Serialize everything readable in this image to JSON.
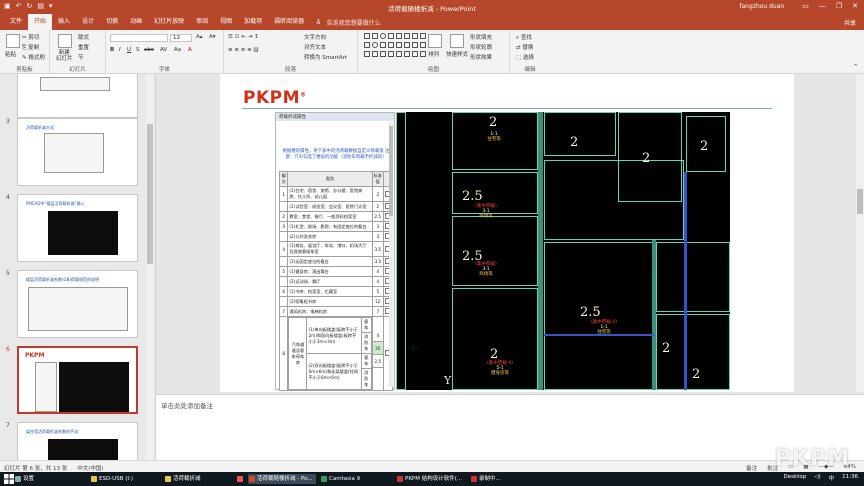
{
  "window": {
    "title": "活荷载随楼折减 - PowerPoint",
    "user": "fangzhou duan",
    "share": "共享"
  },
  "tabs": [
    "文件",
    "开始",
    "插入",
    "设计",
    "切换",
    "动画",
    "幻灯片放映",
    "审阅",
    "视图",
    "加载项",
    "福昕阅读器"
  ],
  "tell_me": "告诉我您想要做什么",
  "ribbon": {
    "clipboard": {
      "label": "剪贴板",
      "paste": "粘贴",
      "cut": "剪切",
      "copy": "复制",
      "format_painter": "格式刷"
    },
    "slides": {
      "label": "幻灯片",
      "new_slide": "新建\n幻灯片",
      "layout": "版式",
      "reset": "重置",
      "section": "节"
    },
    "font": {
      "label": "字体",
      "size": "12"
    },
    "paragraph": {
      "label": "段落",
      "text_direction": "文字方向",
      "align_text": "对齐文本",
      "convert_smartart": "转换为 SmartArt"
    },
    "drawing": {
      "label": "绘图",
      "arrange": "排列",
      "quick_styles": "快速样式",
      "shape_fill": "形状填充",
      "shape_outline": "形状轮廓",
      "shape_effects": "形状效果"
    },
    "editing": {
      "label": "编辑",
      "find": "查找",
      "replace": "替换",
      "select": "选择"
    }
  },
  "thumbnails": [
    {
      "num": "3",
      "title": "活荷载折减方式"
    },
    {
      "num": "4",
      "title": "PMCAD中“楼层活荷载折减”输入"
    },
    {
      "num": "5",
      "title": "楼层活荷载折减系数(GB)荷载规范的说明"
    },
    {
      "num": "6",
      "title": ""
    },
    {
      "num": "7",
      "title": "梁柱墙活荷载折减系数的手动"
    }
  ],
  "slide": {
    "logo": "PKPM",
    "logo_mark": "®",
    "dialog": {
      "title": "荷载折减属性",
      "note": "根据楼的属性，将下表中的活荷载数据自定义荷载值\n注意：只有勾选了楼层的功能（消防车荷载不折减的）",
      "headers": [
        "编次",
        "类别",
        "标准值",
        ""
      ],
      "rows": [
        {
          "idx": "1",
          "desc": "(1)住宅、宿舍、旅馆、办公楼、医院病房、托儿所、幼儿园",
          "val": "2"
        },
        {
          "idx": "",
          "desc": "(2)试验室、阅览室、会议室、医院门诊室",
          "val": "2"
        },
        {
          "idx": "2",
          "desc": "教室、食堂、餐厅、一般资料档案室",
          "val": "2.5"
        },
        {
          "idx": "3",
          "desc": "(1)礼堂、剧场、影院、有固定座位的看台",
          "val": "3"
        },
        {
          "idx": "",
          "desc": "(2)公共洗衣房",
          "val": "3"
        },
        {
          "idx": "4",
          "desc": "(1)商店、展览厅、车站、港口、机场大厅及其旅客候车室",
          "val": "3.5"
        },
        {
          "idx": "",
          "desc": "(2)无固定座位的看台",
          "val": "3.5"
        },
        {
          "idx": "5",
          "desc": "(1)健身房、演出舞台",
          "val": "4"
        },
        {
          "idx": "",
          "desc": "(2)运动场、舞厅",
          "val": "4"
        },
        {
          "idx": "6",
          "desc": "(1)书库、档案室、贮藏室",
          "val": "5"
        },
        {
          "idx": "",
          "desc": "(2)密集柜书库",
          "val": "12"
        },
        {
          "idx": "7",
          "desc": "通风机房、电梯机房",
          "val": "7"
        }
      ],
      "car": {
        "idx": "8",
        "group": "汽车通道及客车停车库",
        "sub1": "(1)单向板楼盖(板跨不小于2m)和双向板楼盖(板跨不小于3m×3m)",
        "sub1_a": "客车",
        "sub1_a_val": "4",
        "sub1_b": "消防车",
        "sub1_b_val": "35",
        "sub2": "(2)双向板楼盖(板跨不小于6m×6m)和无梁楼盖(柱网不小于6m×6m)",
        "sub2_a": "客车",
        "sub2_a_val": "2.5",
        "sub2_b": "消防车"
      }
    },
    "cad": {
      "numbers": [
        {
          "v": "2",
          "cls": "n1"
        },
        {
          "v": "2",
          "cls": "n2"
        },
        {
          "v": "2",
          "cls": "n3"
        },
        {
          "v": "2",
          "cls": "n4"
        },
        {
          "v": "2.5",
          "cls": "n5"
        },
        {
          "v": "2.5",
          "cls": "n6"
        },
        {
          "v": "2.5",
          "cls": "n7"
        },
        {
          "v": "2",
          "cls": "n8"
        },
        {
          "v": "2",
          "cls": "n9"
        },
        {
          "v": "2",
          "cls": "n10"
        }
      ],
      "labels": [
        {
          "cls": "l1",
          "a": "",
          "b": "1-1",
          "c": "住宅等"
        },
        {
          "cls": "l2",
          "a": "(集中荷载)",
          "b": "3-1",
          "c": "商场等"
        },
        {
          "cls": "l3",
          "a": "(集中荷载)",
          "b": "3-1",
          "c": "商场等"
        },
        {
          "cls": "l4",
          "a": "(集中荷载-4)",
          "b": "1-1",
          "c": "住宅等"
        },
        {
          "cls": "l5",
          "a": "(集中荷载-4)",
          "b": "5-1",
          "c": "健身房等"
        }
      ],
      "axis_letter": "Y"
    }
  },
  "notes_placeholder": "单击此处添加备注",
  "status": {
    "slide": "幻灯片 第 6 张，共 13 张",
    "lang": "中文(中国)",
    "notes": "备注",
    "comments": "批注",
    "zoom": "64%"
  },
  "watermark": "PKPM",
  "taskbar": {
    "items": [
      {
        "label": "设置",
        "c": "#8aa"
      },
      {
        "label": "ESD-USB (I:)",
        "c": "#e8c64a"
      },
      {
        "label": "活荷载折减",
        "c": "#e8c64a"
      },
      {
        "label": "",
        "c": "#e55"
      },
      {
        "label": "活荷载随楼折减 - Po...",
        "c": "#d24726",
        "active": true
      },
      {
        "label": "Camtasia 9",
        "c": "#3c9a5f"
      },
      {
        "label": "PKPM 结构设计软件(...",
        "c": "#c33"
      },
      {
        "label": "录制中...",
        "c": "#c33"
      }
    ],
    "desktop": "Desktop",
    "time": "11:36"
  },
  "colors": {
    "accent": "#b7472a",
    "pkpm_red": "#d0311b",
    "cad_bg": "#000000",
    "cad_wall": "#5ed6b8"
  }
}
